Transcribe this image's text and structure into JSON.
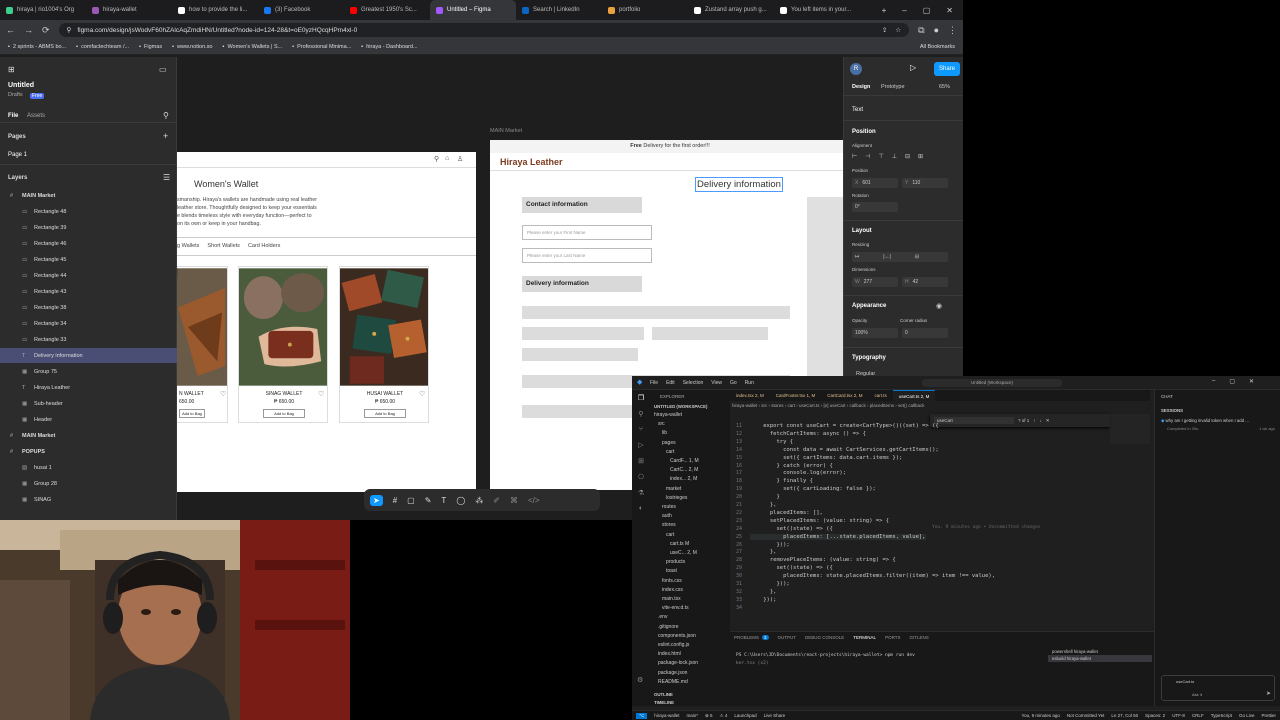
{
  "browser": {
    "tabs": [
      {
        "label": "hiraya | rio1004's Org",
        "color": "#3ecf8e"
      },
      {
        "label": "hiraya-wallet",
        "color": "#9b59b6"
      },
      {
        "label": "how to provide the li...",
        "color": "#ffffff"
      },
      {
        "label": "(3) Facebook",
        "color": "#1877f2"
      },
      {
        "label": "Greatest 1950's Sc...",
        "color": "#ff0000"
      },
      {
        "label": "Untitled – Figma",
        "color": "#a259ff"
      },
      {
        "label": "Search | LinkedIn",
        "color": "#0a66c2"
      },
      {
        "label": "portfolio",
        "color": "#e8a33d"
      },
      {
        "label": "Zustand array push g...",
        "color": "#ffffff"
      },
      {
        "label": "You left items in your...",
        "color": "#ffffff"
      }
    ],
    "url": "figma.com/design/jsWodvF60hZAlcAqZmdiHN/Untitled?node-id=124-28&t=oE0yzHQcqHPm4xl-0",
    "bookmarks": [
      "2 sprints - ABMS bo...",
      "comfactechteam /...",
      "Figmas",
      "www.notion.so",
      "Women's Wallets | S...",
      "Professional Minima...",
      "hiraya - Dashboard..."
    ],
    "all_bookmarks": "All Bookmarks"
  },
  "figma": {
    "file_name": "Untitled",
    "drafts": "Drafts",
    "plan": "Free",
    "tab_file": "File",
    "tab_assets": "Assets",
    "pages_label": "Pages",
    "page1": "Page 1",
    "layers_label": "Layers",
    "layers": [
      {
        "name": "MAIN Market",
        "indent": 0,
        "kind": "frame"
      },
      {
        "name": "Rectangle 48",
        "indent": 1,
        "kind": "rect"
      },
      {
        "name": "Rectangle 39",
        "indent": 1,
        "kind": "rect"
      },
      {
        "name": "Rectangle 46",
        "indent": 1,
        "kind": "rect"
      },
      {
        "name": "Rectangle 45",
        "indent": 1,
        "kind": "rect"
      },
      {
        "name": "Rectangle 44",
        "indent": 1,
        "kind": "rect"
      },
      {
        "name": "Rectangle 43",
        "indent": 1,
        "kind": "rect"
      },
      {
        "name": "Rectangle 38",
        "indent": 1,
        "kind": "rect"
      },
      {
        "name": "Rectangle 34",
        "indent": 1,
        "kind": "rect"
      },
      {
        "name": "Rectangle 33",
        "indent": 1,
        "kind": "rect"
      },
      {
        "name": "Delivery information",
        "indent": 1,
        "kind": "text",
        "selected": true
      },
      {
        "name": "Group 75",
        "indent": 1,
        "kind": "group"
      },
      {
        "name": "Hiraya Leather",
        "indent": 1,
        "kind": "text"
      },
      {
        "name": "Sub-header",
        "indent": 1,
        "kind": "group"
      },
      {
        "name": "Header",
        "indent": 1,
        "kind": "group"
      },
      {
        "name": "MAIN Market",
        "indent": 0,
        "kind": "frame"
      },
      {
        "name": "POPUPS",
        "indent": 0,
        "kind": "frame"
      },
      {
        "name": "husai 1",
        "indent": 1,
        "kind": "image"
      },
      {
        "name": "Group 28",
        "indent": 1,
        "kind": "group"
      },
      {
        "name": "SINAG",
        "indent": 1,
        "kind": "group"
      }
    ],
    "canvas": {
      "frame_label": "MAIN Market",
      "left_frame": {
        "title": "Women's Wallet",
        "desc_line1": "smanship. Hiraya's wallets are handmade using real leather",
        "desc_line2": "leather store. Thoughtfully designed to keep your essentials",
        "desc_line3": "e blends timeless style with everyday function—perfect to",
        "desc_line4": "on its own or keep in your handbag.",
        "categories": [
          "g Wallets",
          "Short Wallets",
          "Card Holders"
        ],
        "products": [
          {
            "name": "N WALLET",
            "price": "650.00",
            "button": "Add to Bag"
          },
          {
            "name": "SINAG WALLET",
            "price": "₱ 650.00",
            "button": "Add to Bag"
          },
          {
            "name": "HUSAI WALLET",
            "price": "₱ 650.00",
            "button": "Add to Bag"
          }
        ]
      },
      "right_frame": {
        "banner_bold": "Free",
        "banner_rest": "Delivery for the first order!!!",
        "brand": "Hiraya Leather",
        "heading": "Delivery information",
        "contact_label": "Contact information",
        "first_name_placeholder": "Please enter your First Name",
        "last_name_placeholder": "Please enter your Last Name",
        "delivery_label": "Delivery information"
      }
    },
    "right_panel": {
      "avatar": "R",
      "share": "Share",
      "tab_design": "Design",
      "tab_prototype": "Prototype",
      "zoom": "65%",
      "layer_type": "Text",
      "position": "Position",
      "alignment": "Alignment",
      "position_sub": "Position",
      "x_label": "X",
      "x": "601",
      "y_label": "Y",
      "y": "110",
      "rotation_label": "Rotation",
      "rotation": "0°",
      "layout": "Layout",
      "resizing": "Resizing",
      "dimensions": "Dimensions",
      "w_label": "W",
      "w": "277",
      "h_label": "H",
      "h": "42",
      "appearance": "Appearance",
      "opacity_label": "Opacity",
      "opacity": "100%",
      "corner_label": "Corner radius",
      "corner": "0",
      "typography": "Typography",
      "typo_sub": "Regular"
    }
  },
  "vscode": {
    "title": "Untitled (Workspace)",
    "menu": [
      "File",
      "Edit",
      "Selection",
      "View",
      "Go",
      "Run"
    ],
    "tabs": [
      {
        "label": "index.tsx 2, M",
        "active": false
      },
      {
        "label": "CardFooter.tsx 1, M",
        "active": false
      },
      {
        "label": "CartCard.tsx 2, M",
        "active": false
      },
      {
        "label": "cart.ts",
        "active": false
      },
      {
        "label": "useCart.ts 2, M",
        "active": true
      }
    ],
    "explorer_title": "EXPLORER",
    "workspace": "UNTITLED (WORKSPACE)",
    "tree": [
      {
        "name": "hiraya-wallet",
        "depth": 1
      },
      {
        "name": "src",
        "depth": 2
      },
      {
        "name": "lib",
        "depth": 3
      },
      {
        "name": "pages",
        "depth": 3
      },
      {
        "name": "cart",
        "depth": 4
      },
      {
        "name": "CardF... 1, M",
        "depth": 5
      },
      {
        "name": "CartC... 2, M",
        "depth": 5
      },
      {
        "name": "index... 2, M",
        "depth": 5
      },
      {
        "name": "market",
        "depth": 4
      },
      {
        "name": "lostrieges",
        "depth": 4
      },
      {
        "name": "routes",
        "depth": 3
      },
      {
        "name": "auth",
        "depth": 3
      },
      {
        "name": "stores",
        "depth": 3
      },
      {
        "name": "cart",
        "depth": 4
      },
      {
        "name": "cart.ts M",
        "depth": 5
      },
      {
        "name": "useC... 2, M",
        "depth": 5
      },
      {
        "name": "products",
        "depth": 4
      },
      {
        "name": "toast",
        "depth": 4
      },
      {
        "name": "fonts.css",
        "depth": 3
      },
      {
        "name": "index.css",
        "depth": 3
      },
      {
        "name": "main.tsx",
        "depth": 3
      },
      {
        "name": "vite-env.d.ts",
        "depth": 3
      },
      {
        "name": ".env",
        "depth": 2
      },
      {
        "name": ".gitignore",
        "depth": 2
      },
      {
        "name": "components.json",
        "depth": 2
      },
      {
        "name": "eslint.config.js",
        "depth": 2
      },
      {
        "name": "index.html",
        "depth": 2
      },
      {
        "name": "package-lock.json",
        "depth": 2
      },
      {
        "name": "package.json",
        "depth": 2
      },
      {
        "name": "README.md",
        "depth": 2
      }
    ],
    "breadcrumb": "hiraya-wallet › src › stores › cart › useCart.ts › [e] useCart › callback › placedItems › set() callback",
    "find_value": "useCart",
    "find_count": "? of 1",
    "code": [
      {
        "n": "11",
        "t": "    export const useCart = create<CartType>()((set) => ({"
      },
      {
        "n": "12",
        "t": "      fetchCartItems: async () => {"
      },
      {
        "n": "13",
        "t": "        try {"
      },
      {
        "n": "14",
        "t": "          const data = await CartServices.getCartItems();"
      },
      {
        "n": "15",
        "t": "          set({ cartItems: data.cart.items });"
      },
      {
        "n": "16",
        "t": "        } catch (error) {"
      },
      {
        "n": "17",
        "t": "          console.log(error);"
      },
      {
        "n": "18",
        "t": "        } finally {"
      },
      {
        "n": "19",
        "t": "          set({ cartLoading: false });"
      },
      {
        "n": "20",
        "t": "        }"
      },
      {
        "n": "21",
        "t": "      },"
      },
      {
        "n": "22",
        "t": "      placedItems: [],"
      },
      {
        "n": "23",
        "t": "      setPlacedItems: (value: string) => {"
      },
      {
        "n": "24",
        "t": "        set((state) => ({"
      },
      {
        "n": "25",
        "t": "          placedItems: [...state.placedItems, value],"
      },
      {
        "n": "26",
        "t": "        }));"
      },
      {
        "n": "27",
        "t": "      },"
      },
      {
        "n": "28",
        "t": "      removePlaceItems: (value: string) => {"
      },
      {
        "n": "29",
        "t": "        set((state) => ({"
      },
      {
        "n": "30",
        "t": "          placedItems: state.placedItems.filter((item) => item !== value),"
      },
      {
        "n": "31",
        "t": "        }));"
      },
      {
        "n": "32",
        "t": "      },"
      },
      {
        "n": "33",
        "t": "    }));"
      },
      {
        "n": "34",
        "t": ""
      }
    ],
    "blame": "You, 9 minutes ago • Uncommitted changes",
    "panel_tabs": [
      "PROBLEMS",
      "OUTPUT",
      "DEBUG CONSOLE",
      "TERMINAL",
      "PORTS",
      "GITLENS"
    ],
    "problems_count": "3",
    "terminal_line1": "PS C:\\Users\\JD\\Documents\\react-projects\\hiraya-wallet> npm run dev",
    "terminal_line2": "ker.tsx (x2)",
    "terminal_sessions": [
      "powershell hiraya-wallet",
      "esbuild hiraya-wallet"
    ],
    "chat_title": "CHAT",
    "sessions_label": "SESSIONS",
    "chat_item": "why am I getting invalid token when I add ...",
    "chat_time": "1 wk ago",
    "chat_completed": "Completed in 39s.",
    "chat_file": "useCart.ts",
    "chat_mode": "Ask ∨",
    "outline": "OUTLINE",
    "timeline": "TIMELINE",
    "status": {
      "branch": "hiraya-wallet",
      "branch2": "main*",
      "errors": "5",
      "warnings": "4",
      "launchpad": "Launchpad",
      "live_share": "Live Share",
      "blame": "You, 9 minutes ago",
      "uncommitted": "Not Committed Yet",
      "position": "Ln 27, Col 50",
      "spaces": "Spaces: 2",
      "encoding": "UTF-8",
      "eol": "CRLF",
      "lang": "TypeScript",
      "golive": "Go Live",
      "prettier": "Prettier"
    }
  }
}
